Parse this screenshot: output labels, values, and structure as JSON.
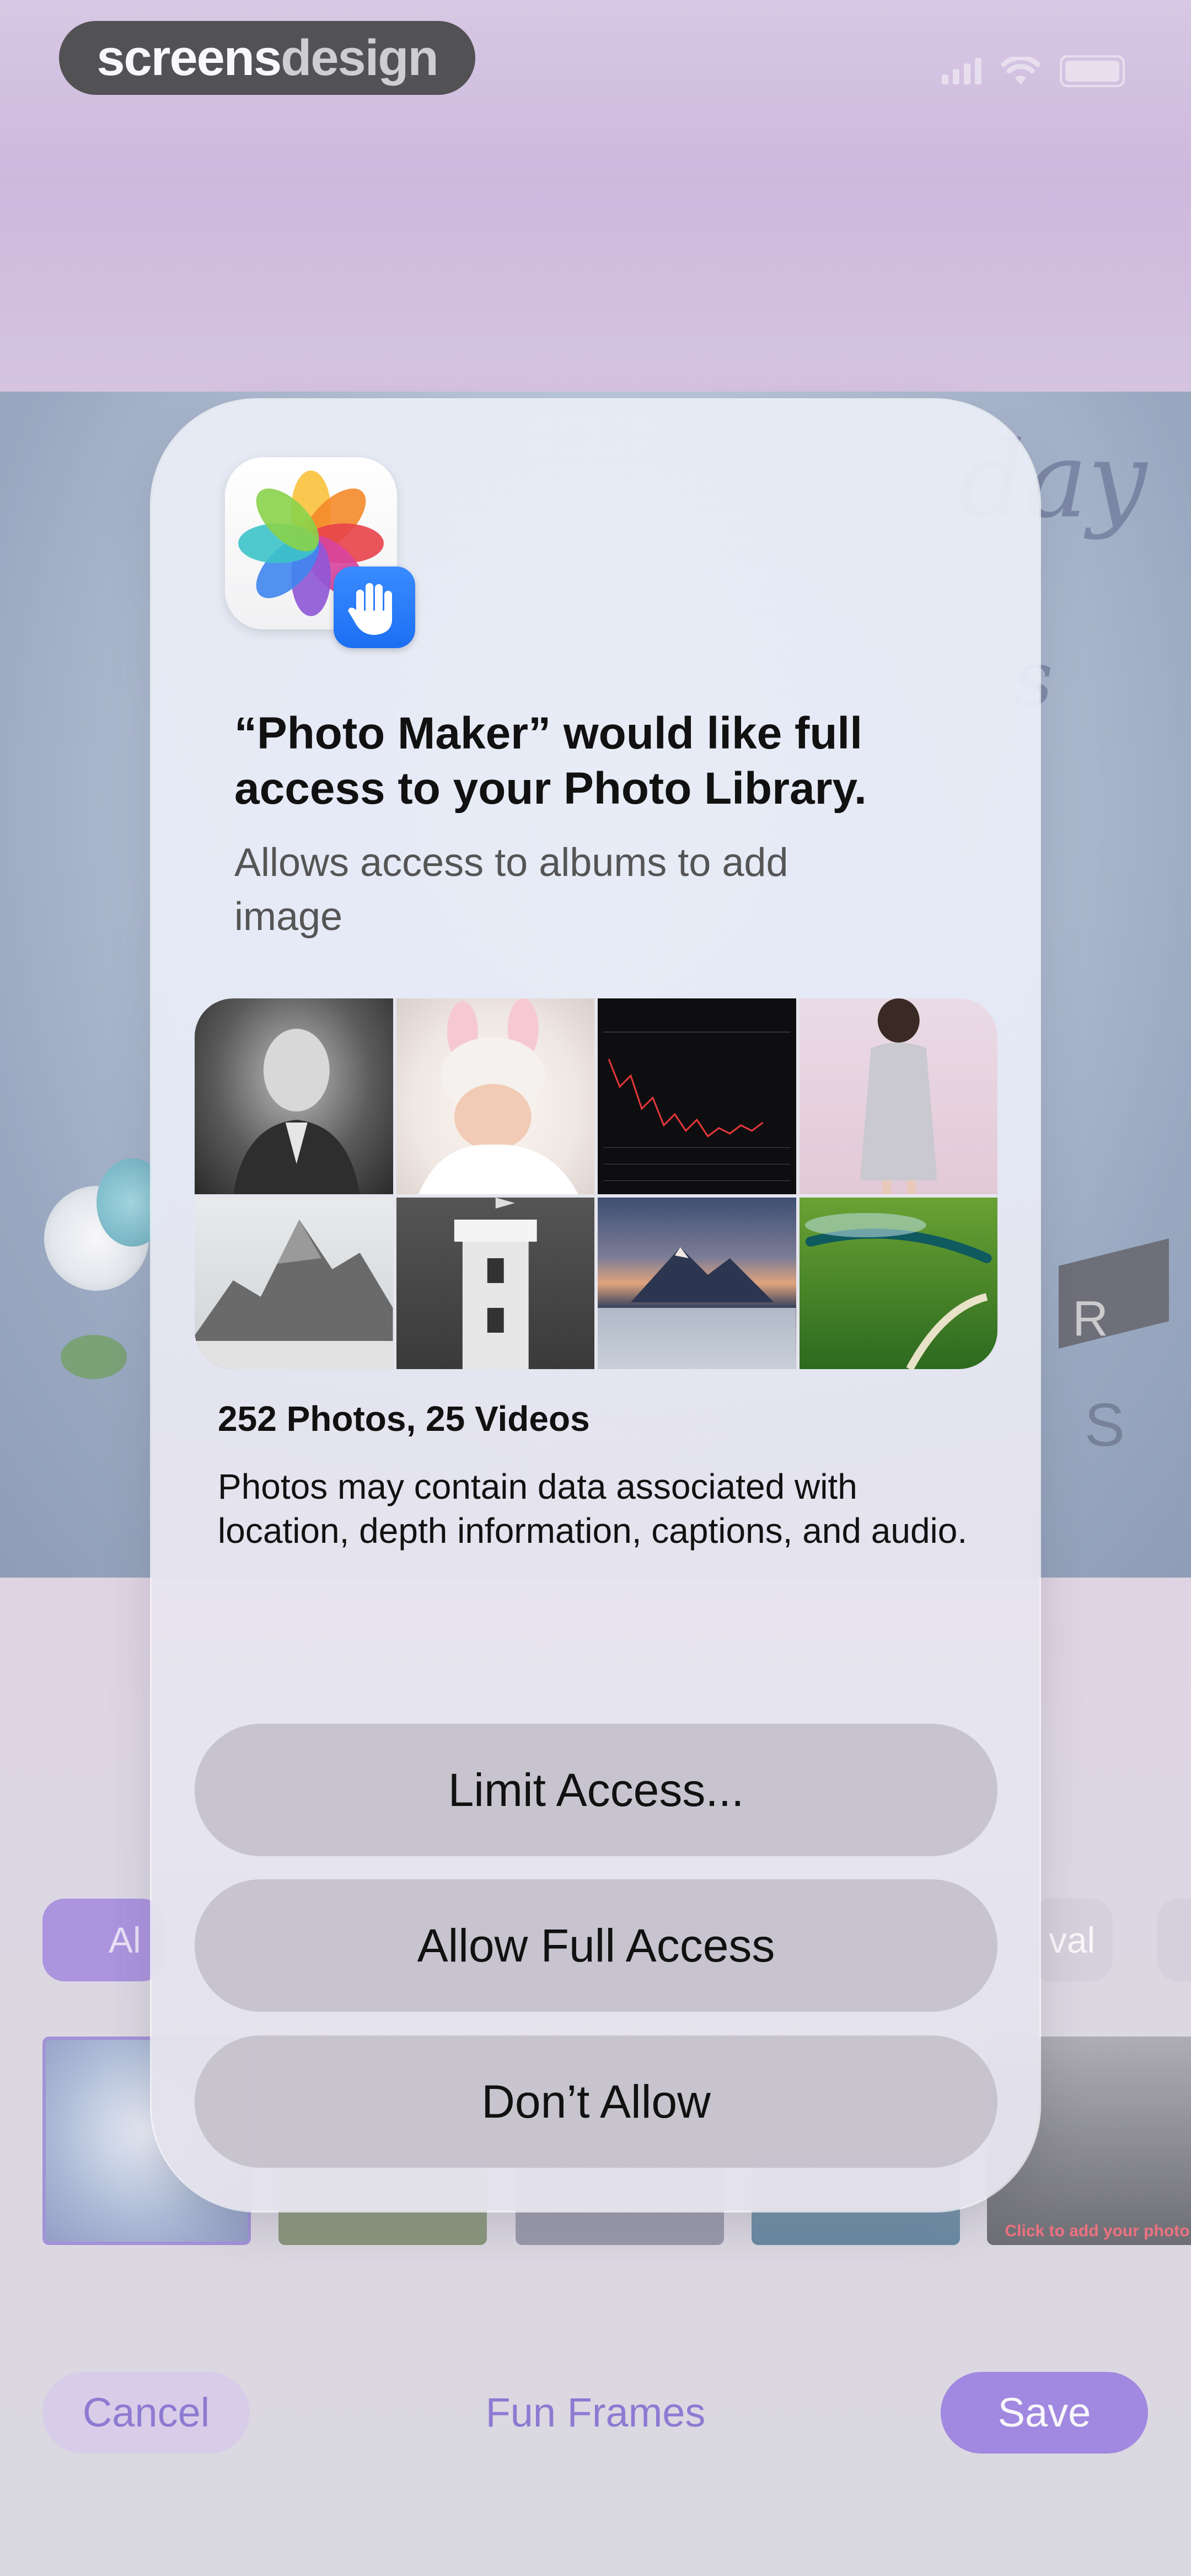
{
  "watermark": {
    "part1": "screens",
    "part2": "design"
  },
  "status_bar": {
    "signal_icon": "signal-icon",
    "wifi_icon": "wifi-icon",
    "battery_icon": "battery-icon"
  },
  "background_app": {
    "category_chips": [
      {
        "label": "Al",
        "selected": true
      },
      {
        "label": "val",
        "selected": false
      },
      {
        "label": "",
        "selected": false
      }
    ],
    "thumb_caption": "Click to add your photo",
    "cancel_label": "Cancel",
    "title": "Fun Frames",
    "save_label": "Save",
    "accent_color": "#7a55d8"
  },
  "permission_dialog": {
    "app_icon": "photos-icon",
    "badge_icon": "hand-icon",
    "title": "“Photo Maker” would like full access to your Photo Library.",
    "subtitle": "Allows access to albums to add image",
    "photo_count": "252 Photos, 25 Videos",
    "disclaimer": "Photos may contain data associated with location, depth information, captions, and audio.",
    "buttons": {
      "limit": "Limit Access...",
      "allow_full": "Allow Full Access",
      "deny": "Don’t Allow"
    }
  }
}
